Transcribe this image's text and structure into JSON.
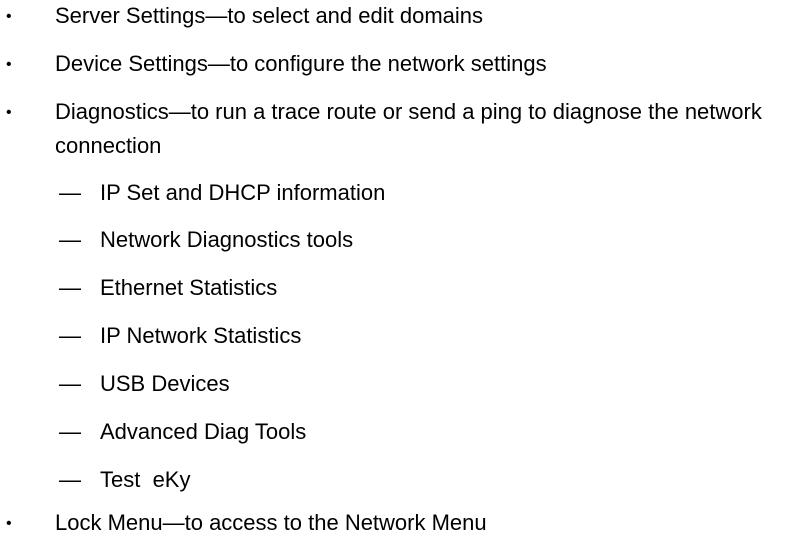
{
  "list": {
    "items": [
      {
        "text": "Server Settings—to select and edit domains"
      },
      {
        "text": "Device Settings—to configure the network settings"
      },
      {
        "text": "Diagnostics—to run a trace route or send a ping to diagnose the network connection"
      },
      {
        "text": "Lock Menu—to access to the Network Menu"
      }
    ],
    "sub_dash": "—",
    "sub_items": [
      {
        "text": "IP Set and DHCP information"
      },
      {
        "text": "Network Diagnostics tools"
      },
      {
        "text": "Ethernet Statistics"
      },
      {
        "text": "IP Network Statistics"
      },
      {
        "text": "USB Devices"
      },
      {
        "text": "Advanced Diag Tools"
      },
      {
        "text": "Test  eKy"
      }
    ]
  }
}
